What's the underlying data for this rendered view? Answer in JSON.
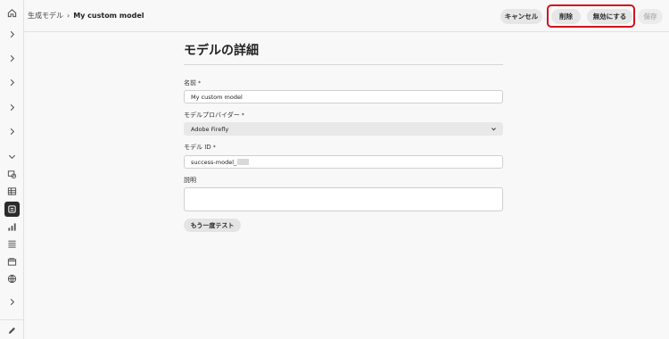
{
  "breadcrumb": {
    "parent": "生成モデル",
    "separator": "›",
    "current": "My custom model"
  },
  "actions": {
    "cancel": "キャンセル",
    "delete": "削除",
    "disable": "無効にする",
    "save": "保存"
  },
  "page": {
    "title": "モデルの詳細"
  },
  "fields": {
    "name": {
      "label": "名前",
      "required_mark": "*",
      "value": "My custom model"
    },
    "provider": {
      "label": "モデルプロバイダー",
      "required_mark": "*",
      "value": "Adobe Firefly"
    },
    "model_id": {
      "label": "モデル ID",
      "required_mark": "*",
      "value": "success-model_"
    },
    "description": {
      "label": "説明",
      "value": ""
    }
  },
  "retest_label": "もう一度テスト",
  "sidebar_icons": [
    "home-icon",
    "chevron-right-icon",
    "chevron-right-icon",
    "chevron-right-icon",
    "chevron-right-icon",
    "chevron-right-icon",
    "chevron-down-icon",
    "sources-icon",
    "table-icon",
    "model-icon",
    "chart-icon",
    "list-icon",
    "folder-icon",
    "globe-icon",
    "chevron-right-icon",
    "pencil-icon"
  ],
  "colors": {
    "highlight": "#d0141d",
    "active_rail": "#2b2b2b"
  }
}
